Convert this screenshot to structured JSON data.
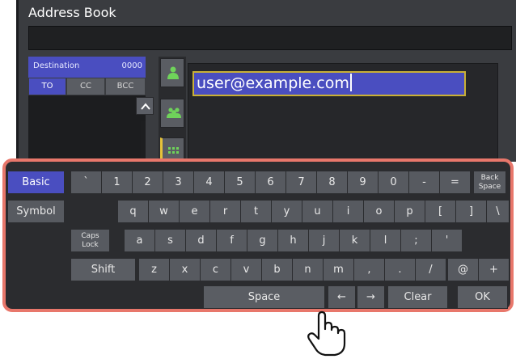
{
  "dialog": {
    "title": "Address Book",
    "destination_label": "Destination",
    "destination_count": "0000",
    "tabs": [
      "TO",
      "CC",
      "BCC"
    ],
    "input_value": "user@example.com"
  },
  "type_buttons": [
    {
      "icon": "person-icon"
    },
    {
      "icon": "group-icon"
    },
    {
      "icon": "grid-icon"
    }
  ],
  "keyboard": {
    "row1": [
      "`",
      "1",
      "2",
      "3",
      "4",
      "5",
      "6",
      "7",
      "8",
      "9",
      "0",
      "-",
      "="
    ],
    "row2": [
      "q",
      "w",
      "e",
      "r",
      "t",
      "y",
      "u",
      "i",
      "o",
      "p",
      "[",
      "]",
      "\\"
    ],
    "row3": [
      "a",
      "s",
      "d",
      "f",
      "g",
      "h",
      "j",
      "k",
      "l",
      ";",
      "'"
    ],
    "row4": [
      "z",
      "x",
      "c",
      "v",
      "b",
      "n",
      "m",
      ",",
      ".",
      "/",
      "@",
      "+"
    ],
    "basic": "Basic",
    "symbol": "Symbol",
    "caps_line1": "Caps",
    "caps_line2": "Lock",
    "shift": "Shift",
    "back_line1": "Back",
    "back_line2": "Space",
    "space": "Space",
    "left_arrow": "←",
    "right_arrow": "→",
    "clear": "Clear",
    "ok": "OK"
  },
  "colors": {
    "accent_blue": "#4a4ec0",
    "highlight_frame": "#e8776b",
    "focus_border": "#c9b036"
  }
}
